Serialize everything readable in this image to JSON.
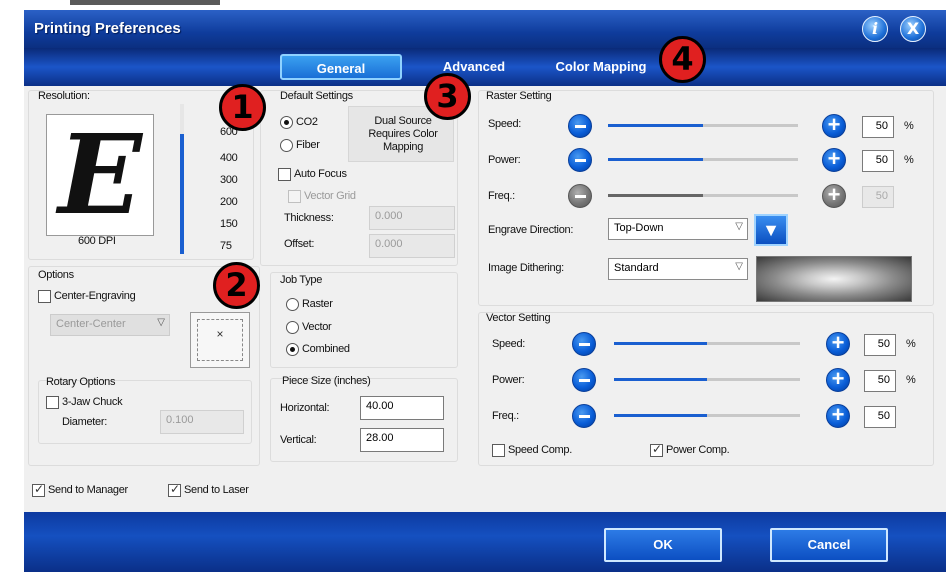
{
  "window": {
    "title": "Printing Preferences",
    "help_icon": "i",
    "close_icon": "X"
  },
  "tabs": [
    "General",
    "Advanced",
    "Color Mapping"
  ],
  "resolution": {
    "label": "Resolution:",
    "preview_letter": "E",
    "dpi_label": "600 DPI",
    "scale": [
      "600",
      "400",
      "300",
      "200",
      "150",
      "75"
    ]
  },
  "default_settings": {
    "label": "Default Settings",
    "co2": "CO2",
    "fiber": "Fiber",
    "dual_source_note": "Dual Source Requires Color Mapping",
    "auto_focus": "Auto Focus",
    "vector_grid": "Vector Grid",
    "thickness_label": "Thickness:",
    "thickness_value": "0.000",
    "offset_label": "Offset:",
    "offset_value": "0.000"
  },
  "options": {
    "label": "Options",
    "center_engraving": "Center-Engraving",
    "center_select": "Center-Center"
  },
  "job_type": {
    "label": "Job Type",
    "raster": "Raster",
    "vector": "Vector",
    "combined": "Combined"
  },
  "rotary": {
    "label": "Rotary Options",
    "chuck": "3-Jaw Chuck",
    "diameter_label": "Diameter:",
    "diameter_value": "0.100"
  },
  "piece_size": {
    "label": "Piece Size (inches)",
    "horizontal_label": "Horizontal:",
    "horizontal_value": "40.00",
    "vertical_label": "Vertical:",
    "vertical_value": "28.00"
  },
  "raster_setting": {
    "label": "Raster Setting",
    "speed_label": "Speed:",
    "speed_value": "50",
    "speed_level": 0.5,
    "power_label": "Power:",
    "power_value": "50",
    "power_level": 0.5,
    "freq_label": "Freq.:",
    "freq_value": "50",
    "freq_level": 0.5,
    "percent": "%",
    "engrave_direction_label": "Engrave Direction:",
    "engrave_direction_value": "Top-Down",
    "dithering_label": "Image Dithering:",
    "dithering_value": "Standard"
  },
  "vector_setting": {
    "label": "Vector Setting",
    "speed_label": "Speed:",
    "speed_value": "50",
    "speed_level": 0.5,
    "power_label": "Power:",
    "power_value": "50",
    "power_level": 0.5,
    "freq_label": "Freq.:",
    "freq_value": "50",
    "freq_level": 0.5,
    "percent": "%",
    "speed_comp": "Speed Comp.",
    "power_comp": "Power Comp."
  },
  "bottom": {
    "send_to_manager": "Send to Manager",
    "send_to_laser": "Send to Laser"
  },
  "buttons": {
    "ok": "OK",
    "cancel": "Cancel"
  },
  "callouts": [
    "1",
    "2",
    "3",
    "4"
  ]
}
